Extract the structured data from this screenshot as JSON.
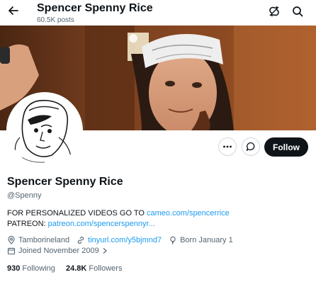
{
  "header": {
    "title": "Spencer Spenny Rice",
    "post_count": "60.5K posts"
  },
  "profile": {
    "name": "Spencer Spenny Rice",
    "handle": "@Spenny",
    "bio_line1_text": "FOR PERSONALIZED VIDEOS GO TO ",
    "bio_line1_link": "cameo.com/spencerrice",
    "bio_line2_text": "PATREON: ",
    "bio_line2_link": "patreon.com/spencerspennyr...",
    "location": "Tamborineland",
    "website": "tinyurl.com/y5bjmnd7",
    "birthday": "Born January 1",
    "joined": "Joined November 2009"
  },
  "actions": {
    "follow_label": "Follow"
  },
  "stats": {
    "following_count": "930",
    "following_label": "Following",
    "followers_count": "24.8K",
    "followers_label": "Followers"
  },
  "colors": {
    "accent": "#1d9bf0",
    "text": "#0f1419",
    "muted": "#536471"
  },
  "icons": [
    "back-arrow-icon",
    "broken-link-icon",
    "search-icon",
    "more-icon",
    "message-icon",
    "location-icon",
    "link-icon",
    "birthday-icon",
    "calendar-icon",
    "chevron-right-icon"
  ]
}
